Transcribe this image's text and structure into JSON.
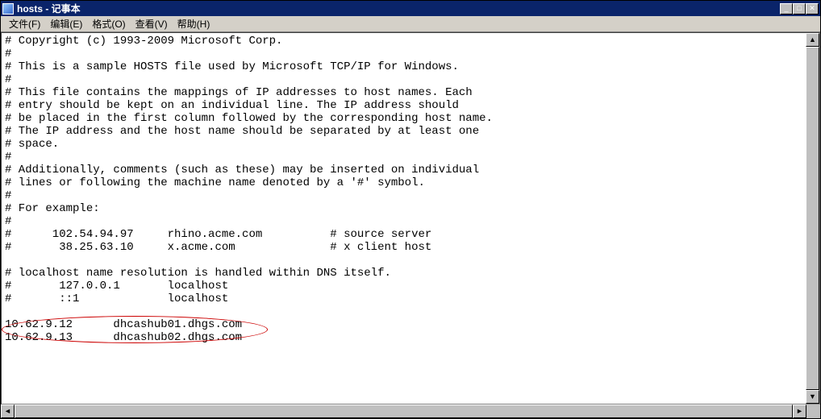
{
  "window": {
    "title": "hosts - 记事本"
  },
  "menu": {
    "file": "文件(F)",
    "edit": "编辑(E)",
    "format": "格式(O)",
    "view": "查看(V)",
    "help": "帮助(H)"
  },
  "content": "# Copyright (c) 1993-2009 Microsoft Corp.\n#\n# This is a sample HOSTS file used by Microsoft TCP/IP for Windows.\n#\n# This file contains the mappings of IP addresses to host names. Each\n# entry should be kept on an individual line. The IP address should\n# be placed in the first column followed by the corresponding host name.\n# The IP address and the host name should be separated by at least one\n# space.\n#\n# Additionally, comments (such as these) may be inserted on individual\n# lines or following the machine name denoted by a '#' symbol.\n#\n# For example:\n#\n#      102.54.94.97     rhino.acme.com          # source server\n#       38.25.63.10     x.acme.com              # x client host\n\n# localhost name resolution is handled within DNS itself.\n#       127.0.0.1       localhost\n#       ::1             localhost\n\n10.62.9.12      dhcashub01.dhgs.com\n10.62.9.13      dhcashub02.dhgs.com",
  "winbtns": {
    "min": "_",
    "max": "□",
    "close": "✕"
  },
  "scroll": {
    "left": "◄",
    "right": "►",
    "up": "▲",
    "down": "▼"
  }
}
